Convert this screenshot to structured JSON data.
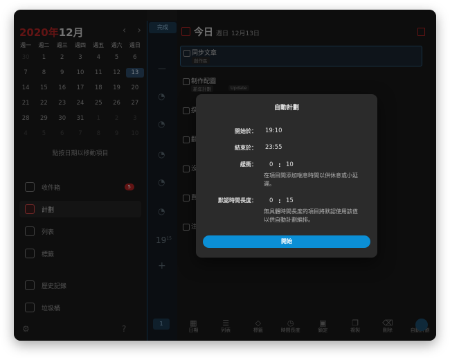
{
  "calendar": {
    "year": "2020年",
    "month": "12月",
    "prev": "‹",
    "next": "›",
    "weekdays": [
      "週一",
      "週二",
      "週三",
      "週四",
      "週五",
      "週六",
      "週日"
    ],
    "days": [
      [
        "30",
        "1",
        "2",
        "3",
        "4",
        "5",
        "6"
      ],
      [
        "7",
        "8",
        "9",
        "10",
        "11",
        "12",
        "13"
      ],
      [
        "14",
        "15",
        "16",
        "17",
        "18",
        "19",
        "20"
      ],
      [
        "21",
        "22",
        "23",
        "24",
        "25",
        "26",
        "27"
      ],
      [
        "28",
        "29",
        "30",
        "31",
        "1",
        "2",
        "3"
      ],
      [
        "4",
        "5",
        "6",
        "7",
        "8",
        "9",
        "10"
      ]
    ],
    "hint": "點按日期以移動項目"
  },
  "sidebar": {
    "inbox": "收件箱",
    "inbox_count": "5",
    "plan": "計劃",
    "list": "列表",
    "tags": "標籤",
    "history": "歷史記錄",
    "trash": "垃圾桶"
  },
  "timeline": {
    "done": "完成",
    "time": "19",
    "time_sup": "15",
    "count": "1"
  },
  "main": {
    "title": "今日",
    "weekday": "週日",
    "date": "12月13日",
    "tasks": [
      {
        "title": "同步文章",
        "tag": "創作區"
      },
      {
        "title": "制作配圖",
        "tag": "新年計劃",
        "tag2": "Update"
      },
      {
        "title": "撰",
        "tag": ""
      },
      {
        "title": "翻",
        "tag": ""
      },
      {
        "title": "沒",
        "tag": ""
      },
      {
        "title": "買",
        "tag": ""
      },
      {
        "title": "注",
        "tag": ""
      }
    ],
    "toolbar": [
      "日期",
      "列表",
      "標籤",
      "時間長度",
      "鎖定",
      "複製",
      "刪除",
      "自動計劃"
    ]
  },
  "modal": {
    "title": "自動計劃",
    "start_label": "開始於：",
    "start_value": "19:10",
    "end_label": "結束於：",
    "end_value": "23:55",
    "buffer_label": "緩衝：",
    "buffer_h": "0",
    "buffer_m": "10",
    "buffer_note": "在項目間添加喘息時間以供休息或小延遲。",
    "default_label": "默認時間長度：",
    "default_h": "0",
    "default_m": "15",
    "default_note": "無具體時間長度的項目將默認使用該值以供自動計劃編排。",
    "colon": ":",
    "start_button": "開始"
  }
}
